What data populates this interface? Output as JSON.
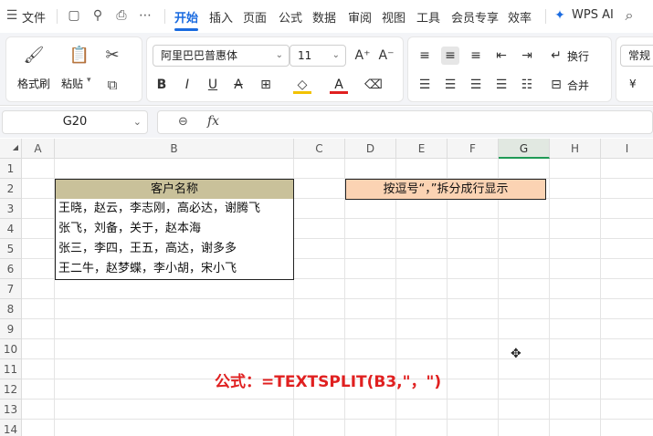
{
  "menubar": {
    "file_label": "文件",
    "tabs": [
      "开始",
      "插入",
      "页面",
      "公式",
      "数据",
      "审阅",
      "视图",
      "工具",
      "会员专享",
      "效率"
    ],
    "active_tab": "开始",
    "ai_label": "WPS AI"
  },
  "ribbon": {
    "format_painter": "格式刷",
    "paste": "粘贴",
    "font_name": "阿里巴巴普惠体",
    "font_size": "11",
    "wrap": "换行",
    "merge": "合并",
    "number_format": "常规",
    "currency_symbol": "¥"
  },
  "formula_bar": {
    "cell_ref": "G20",
    "fx": "fx",
    "content": ""
  },
  "columns": [
    "A",
    "B",
    "C",
    "D",
    "E",
    "F",
    "G",
    "H",
    "I"
  ],
  "selected_column": "G",
  "rows": [
    "1",
    "2",
    "3",
    "4",
    "5",
    "6",
    "7",
    "8",
    "9",
    "10",
    "11",
    "12",
    "13",
    "14"
  ],
  "cells": {
    "B2": "客户名称",
    "B3": "王晓，赵云，李志刚，高必达，谢腾飞",
    "B4": "张飞，刘备，关于，赵本海",
    "B5": "张三，李四，王五，高达，谢多多",
    "B6": "王二牛，赵梦蝶，李小胡，宋小飞",
    "D2": "按逗号“，”拆分成行显示"
  },
  "formula_note": "公式：=TEXTSPLIT(B3,\"，\")",
  "colors": {
    "accent": "#1a6be0",
    "header_fill": "#c9c19a",
    "orange_fill": "#fbd3b3",
    "note_red": "#e02020",
    "selected_col_green": "#1f9a55"
  }
}
